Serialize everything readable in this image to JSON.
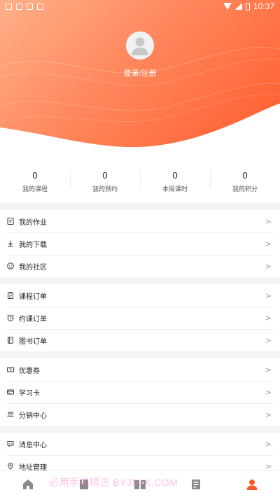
{
  "status_bar": {
    "time": "10:37"
  },
  "profile": {
    "login_label": "登录/注册"
  },
  "stats": [
    {
      "value": "0",
      "label": "我的课程"
    },
    {
      "value": "0",
      "label": "我的预约"
    },
    {
      "value": "0",
      "label": "本周课时"
    },
    {
      "value": "0",
      "label": "我的积分"
    }
  ],
  "groups": [
    {
      "items": [
        {
          "label": "我的作业",
          "icon": "homework-icon"
        },
        {
          "label": "我的下载",
          "icon": "download-icon"
        },
        {
          "label": "我的社区",
          "icon": "community-icon"
        }
      ]
    },
    {
      "items": [
        {
          "label": "课程订单",
          "icon": "course-order-icon"
        },
        {
          "label": "约课订单",
          "icon": "alarm-icon"
        },
        {
          "label": "图书订单",
          "icon": "book-icon"
        }
      ]
    },
    {
      "items": [
        {
          "label": "优惠券",
          "icon": "coupon-icon"
        },
        {
          "label": "学习卡",
          "icon": "card-icon"
        },
        {
          "label": "分销中心",
          "icon": "distribution-icon"
        }
      ]
    },
    {
      "items": [
        {
          "label": "消息中心",
          "icon": "message-icon"
        },
        {
          "label": "地址管理",
          "icon": "location-icon"
        }
      ]
    }
  ],
  "chevron": ">",
  "tabs": [
    {
      "icon": "home-icon",
      "active": false
    },
    {
      "icon": "course-icon",
      "active": false
    },
    {
      "icon": "reading-icon",
      "active": false
    },
    {
      "icon": "document-icon",
      "active": false
    },
    {
      "icon": "profile-icon",
      "active": true
    }
  ],
  "watermark": "必用手机精选 BYJSJX.COM",
  "colors": {
    "accent": "#ff5a2a",
    "tab_inactive": "#8a8a8a",
    "gradient_start": "#ffb08a",
    "gradient_end": "#ff5a2a"
  }
}
